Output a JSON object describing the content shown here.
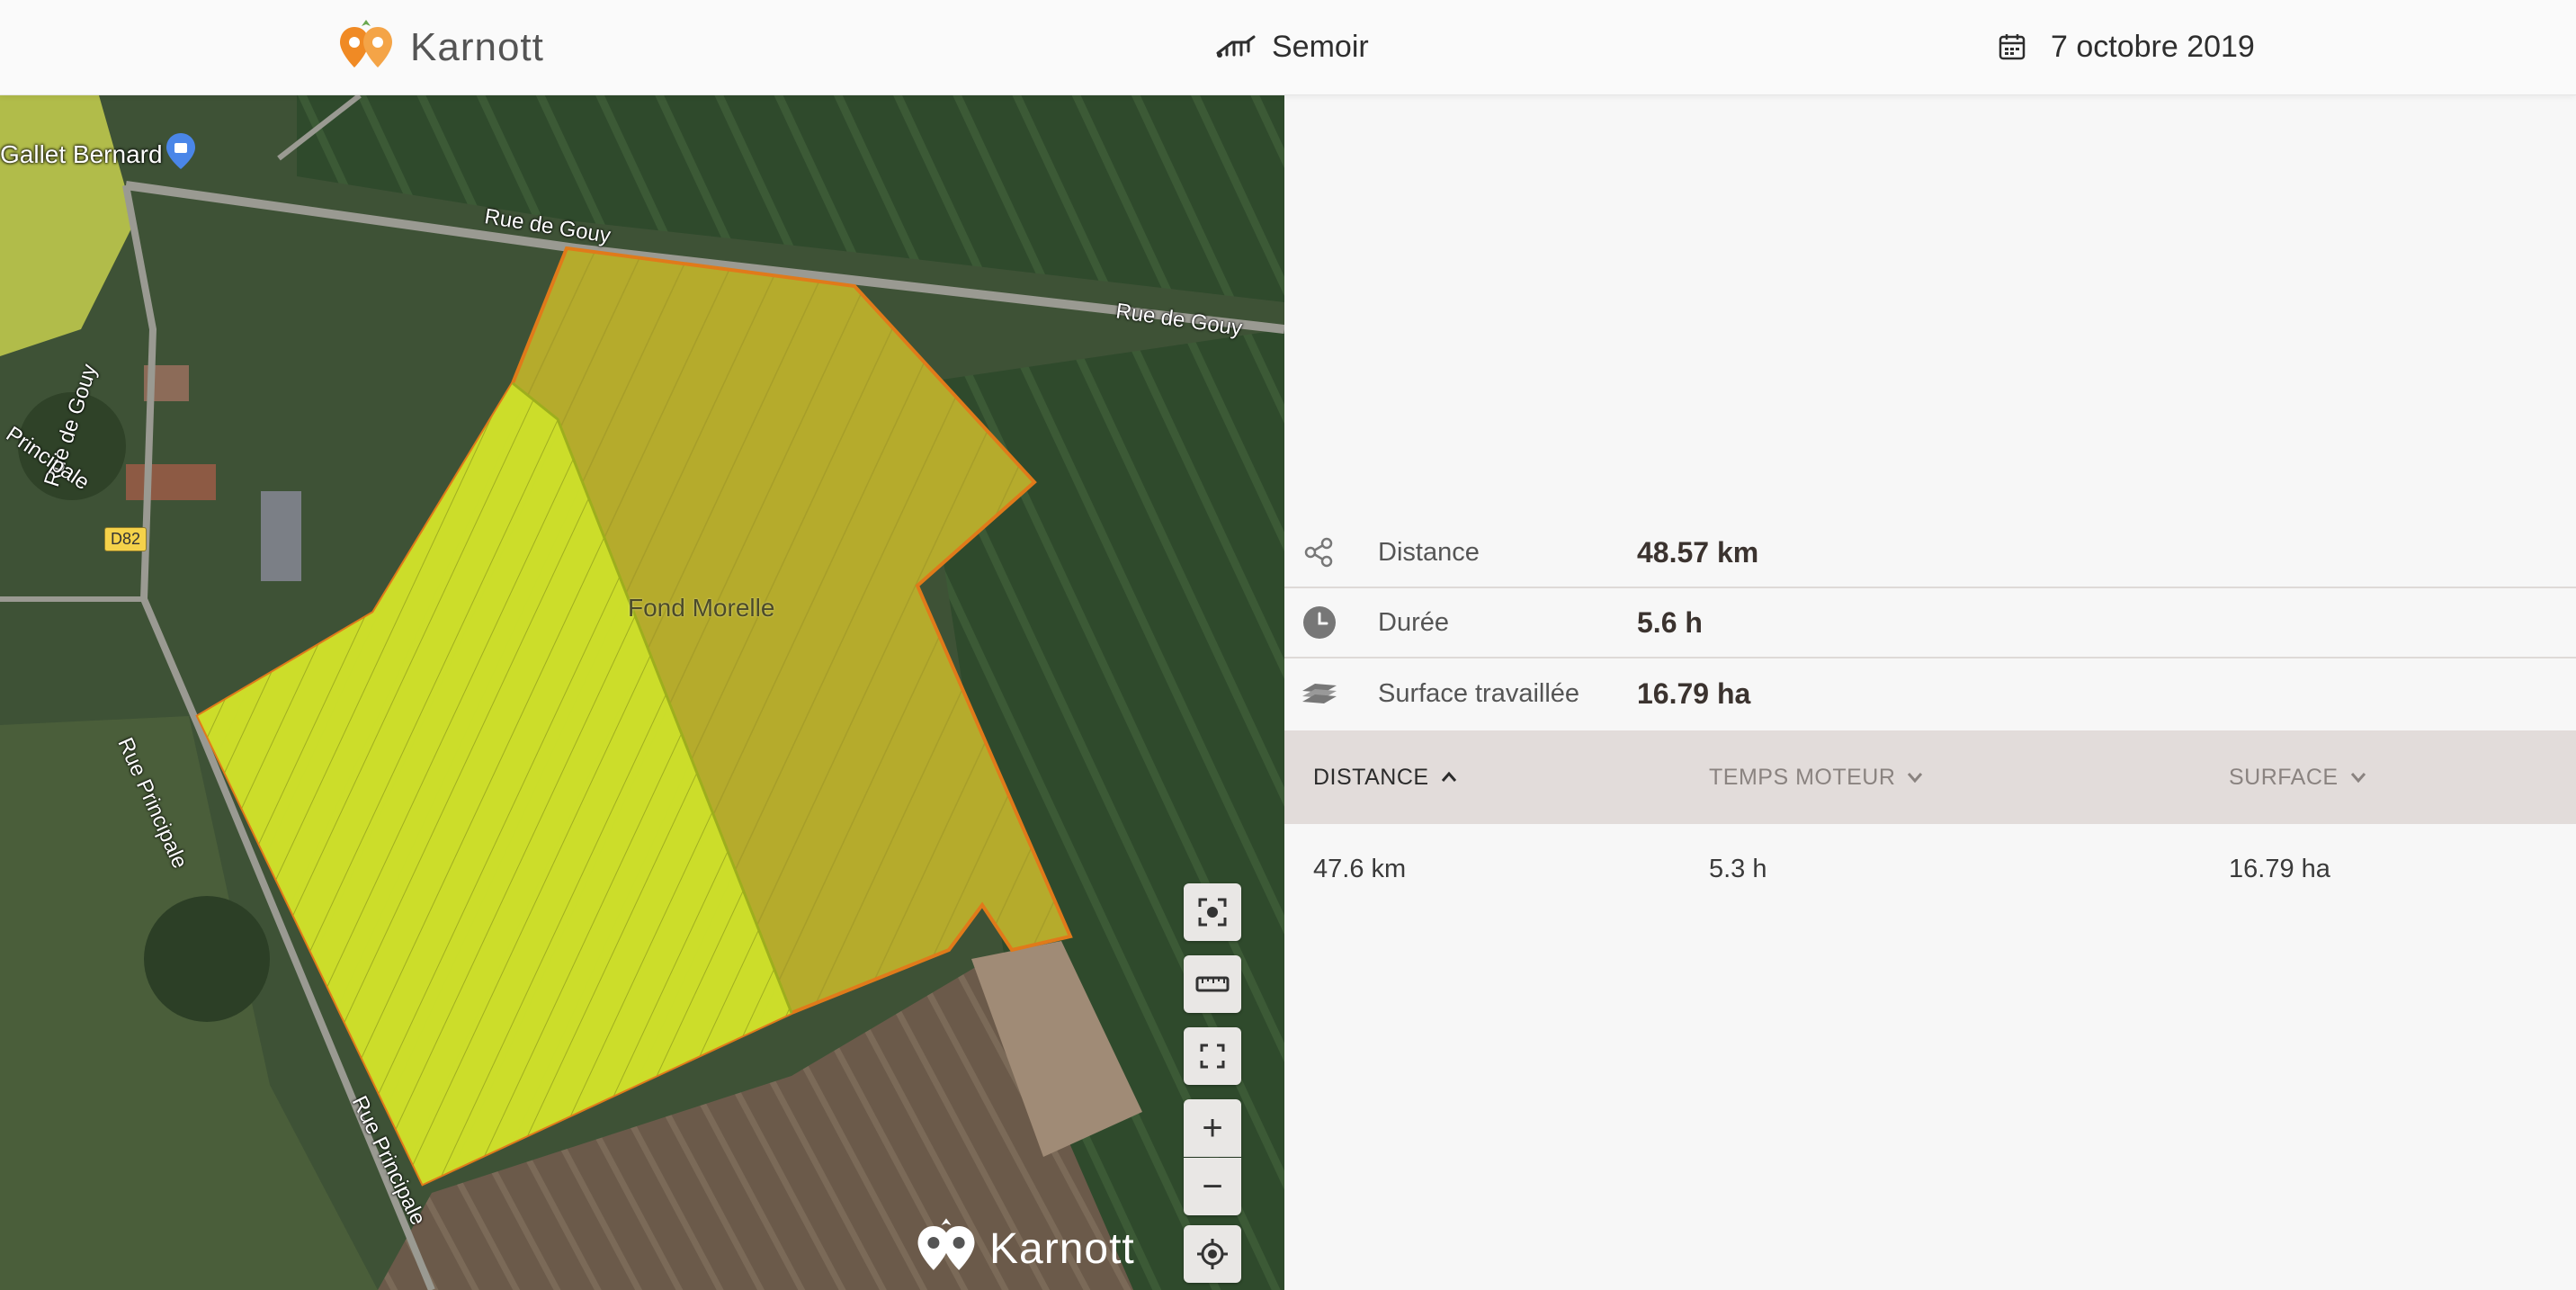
{
  "header": {
    "brand": "Karnott",
    "equipment": "Semoir",
    "date": "7 octobre 2019"
  },
  "map": {
    "field_name": "Fond Morelle",
    "poi": "Gallet Bernard",
    "roads": {
      "gouy_1": "Rue de Gouy",
      "gouy_2": "Rue de Gouy",
      "gouy_vertical": "Rue de Gouy",
      "principale_1": "Principale",
      "principale_2": "Rue Principale",
      "principale_3": "Rue Principale",
      "d82": "D82"
    },
    "controls": {
      "zoom_in": "+",
      "zoom_out": "−"
    },
    "watermark": "Karnott",
    "work_progress": 0.55,
    "colors": {
      "field_fill": "#b9ae2a",
      "worked_fill": "#c9db24",
      "field_border": "#e07a1a"
    }
  },
  "stats": [
    {
      "icon": "share-nodes-icon",
      "label": "Distance",
      "value": "48.57 km"
    },
    {
      "icon": "clock-icon",
      "label": "Durée",
      "value": "5.6 h"
    },
    {
      "icon": "layers-icon",
      "label": "Surface travaillée",
      "value": "16.79 ha"
    }
  ],
  "table": {
    "headers": [
      {
        "label": "DISTANCE",
        "sort": "asc",
        "active": true
      },
      {
        "label": "TEMPS MOTEUR",
        "sort": "desc",
        "active": false
      },
      {
        "label": "SURFACE",
        "sort": "desc",
        "active": false
      }
    ],
    "rows": [
      [
        "47.6 km",
        "5.3 h",
        "16.79 ha"
      ]
    ]
  },
  "colors": {
    "brand_orange": "#f08a24",
    "brand_green": "#6aa84f",
    "table_header_bg": "#e2dcda"
  }
}
